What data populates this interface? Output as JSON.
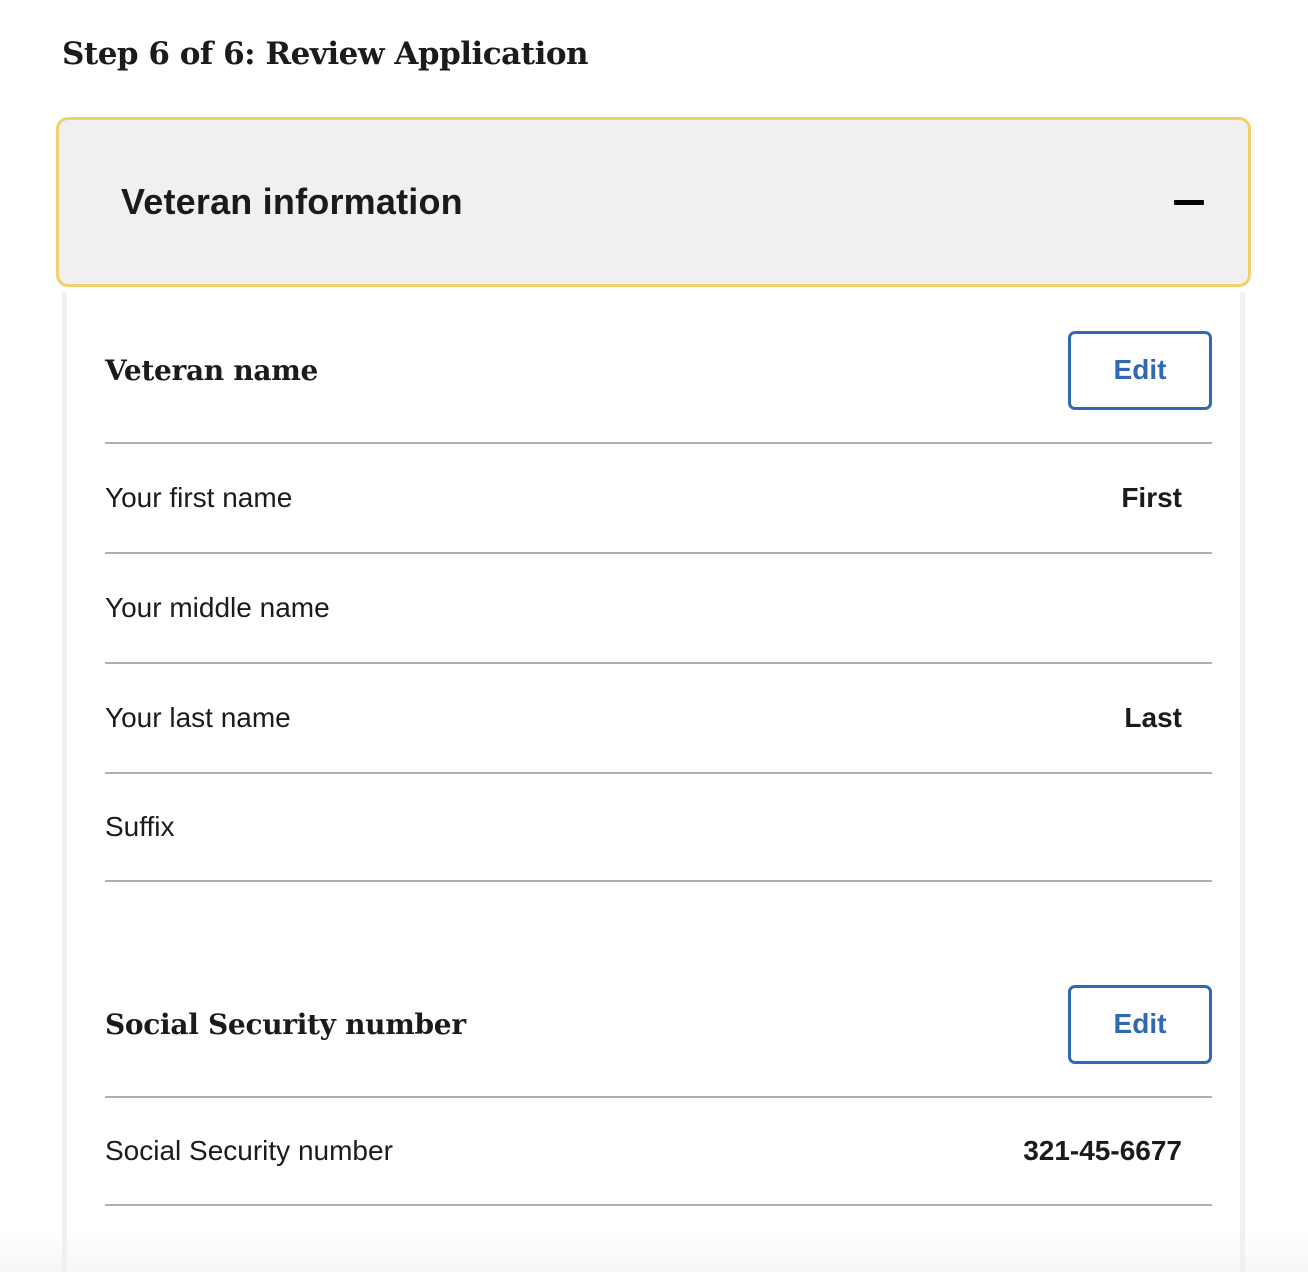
{
  "page": {
    "step_title": "Step 6 of 6: Review Application"
  },
  "accordion": {
    "title": "Veteran information",
    "toggle_icon": "minus-icon",
    "border_color": "#f0d169",
    "background": "#f0f0f0"
  },
  "sections": {
    "veteran_name": {
      "title": "Veteran name",
      "edit_label": "Edit",
      "fields": [
        {
          "label": "Your first name",
          "value": "First"
        },
        {
          "label": "Your middle name",
          "value": ""
        },
        {
          "label": "Your last name",
          "value": "Last"
        },
        {
          "label": "Suffix",
          "value": ""
        }
      ]
    },
    "ssn": {
      "title": "Social Security number",
      "edit_label": "Edit",
      "fields": [
        {
          "label": "Social Security number",
          "value": "321-45-6677"
        }
      ]
    }
  },
  "colors": {
    "link_blue": "#2e69b1",
    "text": "#1b1b1b",
    "divider": "#b0b0b0"
  }
}
